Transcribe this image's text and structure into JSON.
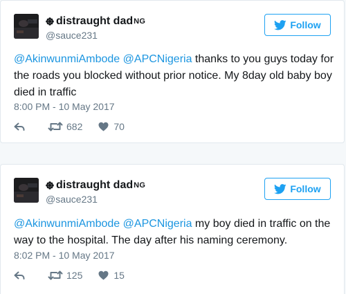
{
  "tweets": [
    {
      "author": {
        "name": "distraught dad",
        "country_badge": "NG",
        "handle": "@sauce231"
      },
      "follow_label": "Follow",
      "text": {
        "mention1": "@AkinwunmiAmbode",
        "space": " ",
        "mention2": "@APCNigeria",
        "body": " thanks to you guys today for the roads you blocked without prior notice. My 8day old baby boy died in traffic"
      },
      "timestamp": "8:00 PM - 10 May 2017",
      "retweets": "682",
      "likes": "70"
    },
    {
      "author": {
        "name": "distraught dad",
        "country_badge": "NG",
        "handle": "@sauce231"
      },
      "follow_label": "Follow",
      "text": {
        "mention1": "@AkinwunmiAmbode",
        "space": " ",
        "mention2": "@APCNigeria",
        "body": " my boy died in traffic on the way to the hospital. The day after his naming ceremony."
      },
      "timestamp": "8:02 PM - 10 May 2017",
      "retweets": "125",
      "likes": "15"
    }
  ],
  "colors": {
    "accent": "#1da1f2",
    "mention": "#1b95e0",
    "muted": "#657786",
    "text": "#14171a",
    "background": "#f5f8fa",
    "card_border": "#e1e8ed"
  },
  "icons": {
    "follow": "twitter-bird-icon",
    "reply": "reply-icon",
    "retweet": "retweet-icon",
    "like": "heart-icon",
    "name_badge": "flower-icon"
  }
}
